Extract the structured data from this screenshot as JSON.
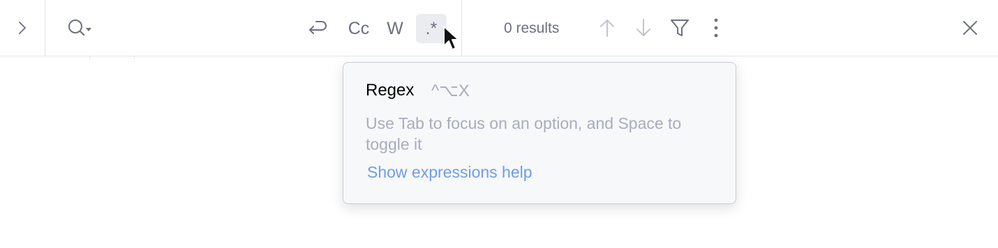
{
  "toolbar": {
    "icons": {
      "expand": "chevron-right-icon",
      "search": "search-history-icon",
      "wrap": "word-wrap-icon",
      "prev": "arrow-up-icon",
      "next": "arrow-down-icon",
      "filter": "filter-icon",
      "more": "more-vertical-icon",
      "close": "close-icon",
      "cursor": "mouse-pointer-icon"
    },
    "match_case_label": "Cc",
    "whole_words_label": "W",
    "regex_label": ".*",
    "regex_active": true,
    "results_text": "0 results"
  },
  "tooltip": {
    "title": "Regex",
    "shortcut": "^⌥X",
    "description": "Use Tab to focus on an option, and Space to toggle it",
    "link_text": "Show expressions help"
  },
  "colors": {
    "icon": "#6c707e",
    "link": "#6f9de8",
    "muted": "#a8adbd",
    "active_bg": "#ebecf0"
  }
}
